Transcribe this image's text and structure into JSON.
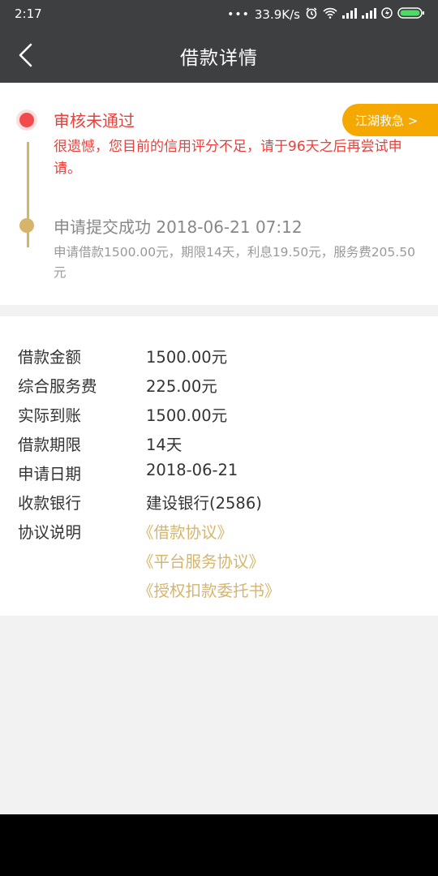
{
  "status_bar": {
    "time": "2:17",
    "net_speed": "33.9K/s",
    "icons": [
      "dots-icon",
      "alarm-icon",
      "wifi-icon",
      "signal-icon",
      "signal-icon",
      "charging-icon",
      "battery-icon"
    ]
  },
  "app_bar": {
    "title": "借款详情",
    "back_icon": "chevron-left-icon"
  },
  "status_card": {
    "status_title": "审核未通过",
    "status_desc": "很遗憾，您目前的信用评分不足，请于96天之后再尝试申请。",
    "help_button": "江湖救急 >",
    "submitted_title": "申请提交成功 2018-06-21 07:12",
    "submitted_desc": "申请借款1500.00元，期限14天，利息19.50元，服务费205.50元"
  },
  "details": {
    "rows": [
      {
        "label": "借款金额",
        "value": "1500.00元"
      },
      {
        "label": "综合服务费",
        "value": "225.00元"
      },
      {
        "label": "实际到账",
        "value": "1500.00元"
      },
      {
        "label": "借款期限",
        "value": "14天"
      },
      {
        "label": "申请日期",
        "value": "2018-06-21"
      },
      {
        "label": "收款银行",
        "value": "建设银行(2586)"
      }
    ],
    "agreement_label": "协议说明",
    "agreements": [
      "《借款协议》",
      "《平台服务协议》",
      "《授权扣款委托书》"
    ]
  },
  "colors": {
    "header": "#3d3f41",
    "status_red": "#e8413c",
    "gold": "#d6b56a",
    "help_orange": "#f5a800"
  }
}
